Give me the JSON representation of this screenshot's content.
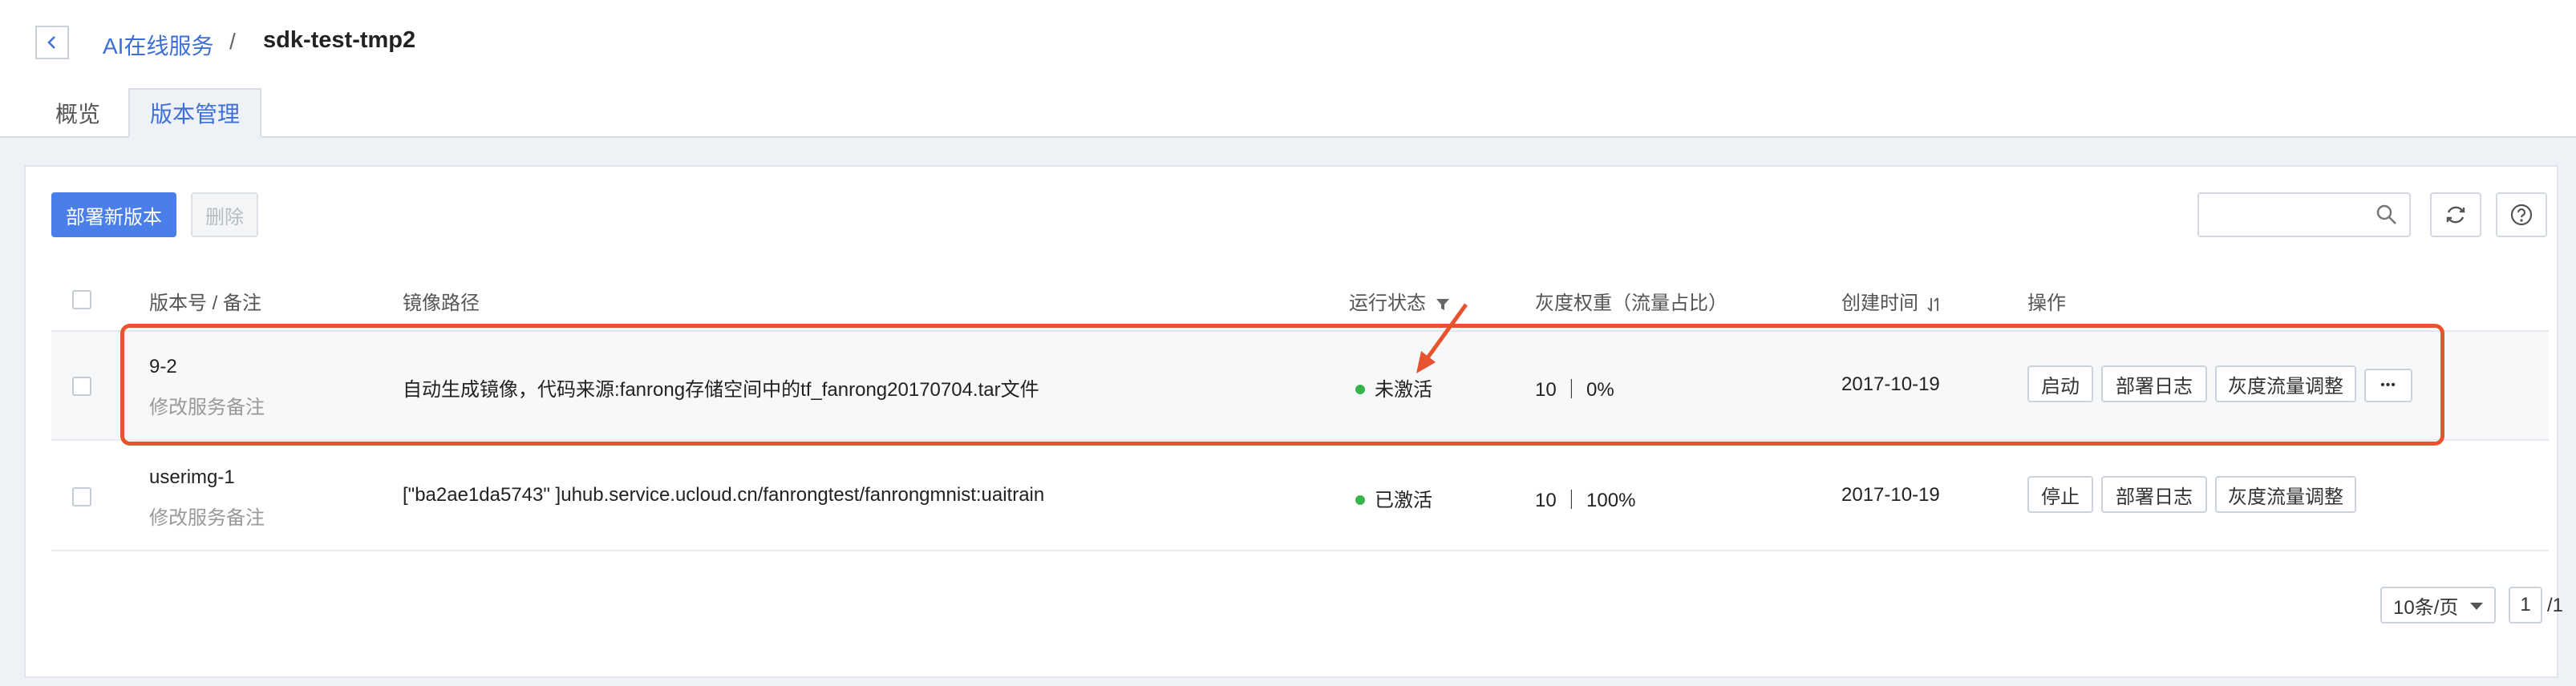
{
  "breadcrumb": {
    "parent": "AI在线服务",
    "separator": "/",
    "current": "sdk-test-tmp2"
  },
  "tabs": [
    {
      "label": "概览",
      "active": false
    },
    {
      "label": "版本管理",
      "active": true
    }
  ],
  "toolbar": {
    "deploy_label": "部署新版本",
    "delete_label": "删除",
    "search_placeholder": "",
    "icons": [
      "search-icon",
      "refresh-icon",
      "help-icon"
    ]
  },
  "table": {
    "columns": [
      "版本号 / 备注",
      "镜像路径",
      "运行状态",
      "灰度权重（流量占比）",
      "创建时间",
      "操作"
    ],
    "rows": [
      {
        "version": "9-2",
        "note": "修改服务备注",
        "image": "自动生成镜像，代码来源:fanrong存储空间中的tf_fanrong20170704.tar文件",
        "status": "未激活",
        "weight": "10 ｜ 0%",
        "created": "2017-10-19",
        "actions": [
          "启动",
          "部署日志",
          "灰度流量调整"
        ],
        "more": "•••"
      },
      {
        "version": "userimg-1",
        "note": "修改服务备注",
        "image": "[\"ba2ae1da5743\" ]uhub.service.ucloud.cn/fanrongtest/fanrongmnist:uaitrain",
        "status": "已激活",
        "weight": "10 ｜ 100%",
        "created": "2017-10-19",
        "actions": [
          "停止",
          "部署日志",
          "灰度流量调整"
        ]
      }
    ]
  },
  "pagination": {
    "page_size": "10条/页",
    "page": "1",
    "total": "/1"
  },
  "colors": {
    "accent": "#4a7ee8",
    "link": "#3e6fd6",
    "highlight": "#e8532f",
    "status_dot": "#37b24d"
  }
}
